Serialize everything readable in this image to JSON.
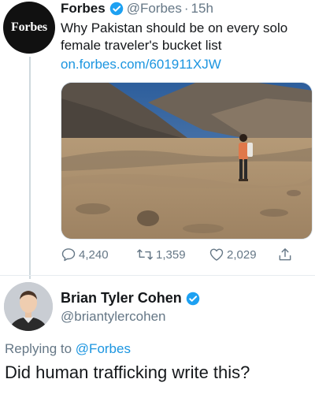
{
  "original_tweet": {
    "avatar_text": "Forbes",
    "display_name": "Forbes",
    "verified_icon": "verified-badge-icon",
    "handle": "@Forbes",
    "separator": "·",
    "time": "15h",
    "text": "Why Pakistan should be on every solo female traveler's bucket list",
    "link": "on.forbes.com/601911XJW",
    "actions": {
      "reply_icon": "reply-icon",
      "reply_count": "4,240",
      "retweet_icon": "retweet-icon",
      "retweet_count": "1,359",
      "like_icon": "heart-icon",
      "like_count": "2,029",
      "share_icon": "share-icon"
    }
  },
  "reply": {
    "display_name": "Brian Tyler Cohen",
    "verified_icon": "verified-badge-icon",
    "handle": "@briantylercohen",
    "replying_prefix": "Replying to",
    "replying_to": "@Forbes",
    "text": "Did human trafficking write this?"
  },
  "colors": {
    "link_blue": "#1b95e0",
    "verified_blue": "#1da1f2",
    "muted_gray": "#657786",
    "text_dark": "#14171a"
  }
}
